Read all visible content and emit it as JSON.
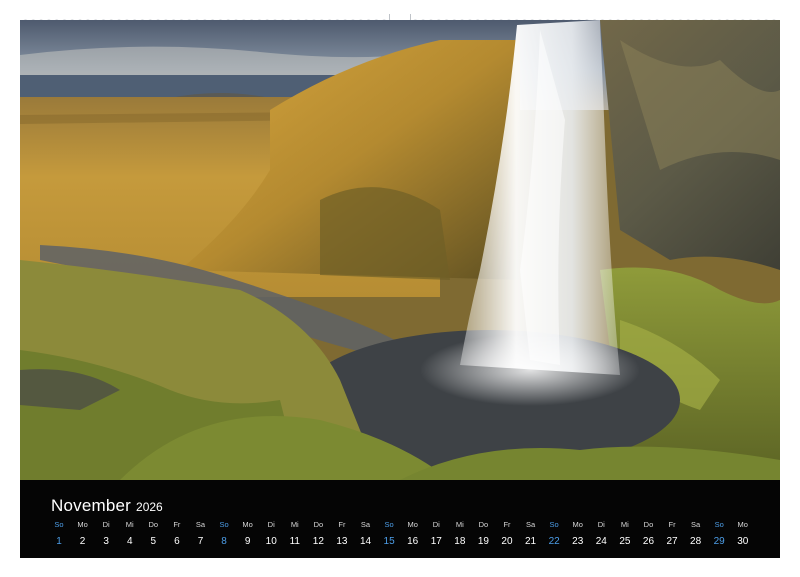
{
  "calendar": {
    "month": "November",
    "year": "2026",
    "sunday_color": "#4d9ee8",
    "days": [
      {
        "name": "So",
        "num": "1",
        "sunday": true
      },
      {
        "name": "Mo",
        "num": "2"
      },
      {
        "name": "Di",
        "num": "3"
      },
      {
        "name": "Mi",
        "num": "4"
      },
      {
        "name": "Do",
        "num": "5"
      },
      {
        "name": "Fr",
        "num": "6"
      },
      {
        "name": "Sa",
        "num": "7"
      },
      {
        "name": "So",
        "num": "8",
        "sunday": true
      },
      {
        "name": "Mo",
        "num": "9"
      },
      {
        "name": "Di",
        "num": "10"
      },
      {
        "name": "Mi",
        "num": "11"
      },
      {
        "name": "Do",
        "num": "12"
      },
      {
        "name": "Fr",
        "num": "13"
      },
      {
        "name": "Sa",
        "num": "14"
      },
      {
        "name": "So",
        "num": "15",
        "sunday": true
      },
      {
        "name": "Mo",
        "num": "16"
      },
      {
        "name": "Di",
        "num": "17"
      },
      {
        "name": "Mi",
        "num": "18"
      },
      {
        "name": "Do",
        "num": "19"
      },
      {
        "name": "Fr",
        "num": "20"
      },
      {
        "name": "Sa",
        "num": "21"
      },
      {
        "name": "So",
        "num": "22",
        "sunday": true
      },
      {
        "name": "Mo",
        "num": "23"
      },
      {
        "name": "Di",
        "num": "24"
      },
      {
        "name": "Mi",
        "num": "25"
      },
      {
        "name": "Do",
        "num": "26"
      },
      {
        "name": "Fr",
        "num": "27"
      },
      {
        "name": "Sa",
        "num": "28"
      },
      {
        "name": "So",
        "num": "29",
        "sunday": true
      },
      {
        "name": "Mo",
        "num": "30"
      }
    ]
  },
  "photo": {
    "subject": "waterfall-landscape-image"
  }
}
